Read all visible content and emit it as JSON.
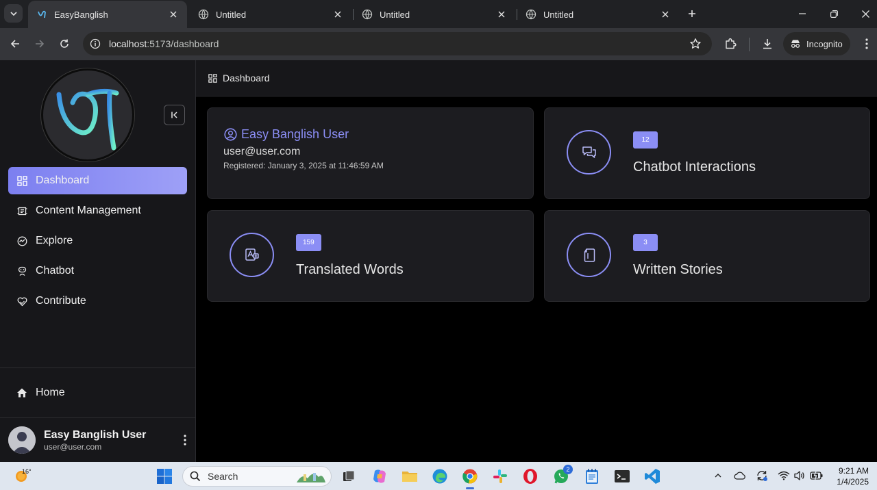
{
  "browser": {
    "tabs": [
      {
        "title": "EasyBanglish",
        "active": true
      },
      {
        "title": "Untitled",
        "active": false
      },
      {
        "title": "Untitled",
        "active": false
      },
      {
        "title": "Untitled",
        "active": false
      }
    ],
    "url_host": "localhost",
    "url_path": ":5173/dashboard",
    "incognito_label": "Incognito"
  },
  "sidebar": {
    "items": [
      {
        "label": "Dashboard",
        "icon": "dashboard-icon",
        "active": true
      },
      {
        "label": "Content Management",
        "icon": "content-icon",
        "active": false
      },
      {
        "label": "Explore",
        "icon": "explore-icon",
        "active": false
      },
      {
        "label": "Chatbot",
        "icon": "chatbot-icon",
        "active": false
      },
      {
        "label": "Contribute",
        "icon": "contribute-icon",
        "active": false
      }
    ],
    "home_label": "Home",
    "user": {
      "name": "Easy Banglish User",
      "email": "user@user.com"
    }
  },
  "header": {
    "title": "Dashboard"
  },
  "profile": {
    "name": "Easy Banglish User",
    "email": "user@user.com",
    "registered": "Registered: January 3, 2025 at 11:46:59 AM"
  },
  "stats": {
    "chatbot": {
      "count": "12",
      "label": "Chatbot Interactions"
    },
    "translated": {
      "count": "159",
      "label": "Translated Words"
    },
    "stories": {
      "count": "3",
      "label": "Written Stories"
    }
  },
  "taskbar": {
    "temperature": "16°",
    "search_placeholder": "Search",
    "whatsapp_badge": "2",
    "time": "9:21 AM",
    "date": "1/4/2025"
  },
  "colors": {
    "accent": "#8b8ef5",
    "sidebar_bg": "#17171a",
    "card_bg": "#1c1c20"
  }
}
